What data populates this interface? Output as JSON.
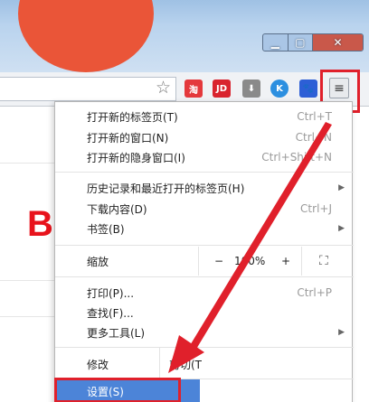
{
  "toolbar": {
    "star_icon": "star-icon",
    "extensions": [
      {
        "name": "taobao",
        "glyph": "淘"
      },
      {
        "name": "jd",
        "glyph": "JD"
      },
      {
        "name": "download",
        "glyph": "⬇"
      },
      {
        "name": "k",
        "glyph": "K"
      },
      {
        "name": "baidu-paw",
        "glyph": "🐾"
      }
    ],
    "menu_glyph": "≡"
  },
  "page": {
    "big_letter": "B"
  },
  "menu": {
    "items": [
      {
        "label": "打开新的标签页(T)",
        "shortcut": "Ctrl+T"
      },
      {
        "label": "打开新的窗口(N)",
        "shortcut": "Ctrl+N"
      },
      {
        "label": "打开新的隐身窗口(I)",
        "shortcut": "Ctrl+Shift+N"
      },
      {
        "label": "历史记录和最近打开的标签页(H)",
        "arrow": "▶"
      },
      {
        "label": "下载内容(D)",
        "shortcut": "Ctrl+J"
      },
      {
        "label": "书签(B)",
        "arrow": "▶"
      },
      {
        "label": "打印(P)...",
        "shortcut": "Ctrl+P"
      },
      {
        "label": "查找(F)...",
        "shortcut": ""
      },
      {
        "label": "更多工具(L)",
        "arrow": "▶"
      }
    ],
    "zoom": {
      "label": "缩放",
      "minus": "−",
      "value": "100%",
      "plus": "+",
      "fullscreen": "⛶"
    },
    "edit": {
      "label": "修改",
      "cut": "剪切(T"
    },
    "settings": {
      "label": "设置(S)"
    }
  },
  "colors": {
    "highlight": "#e0202b",
    "selection": "#4c84d8"
  }
}
